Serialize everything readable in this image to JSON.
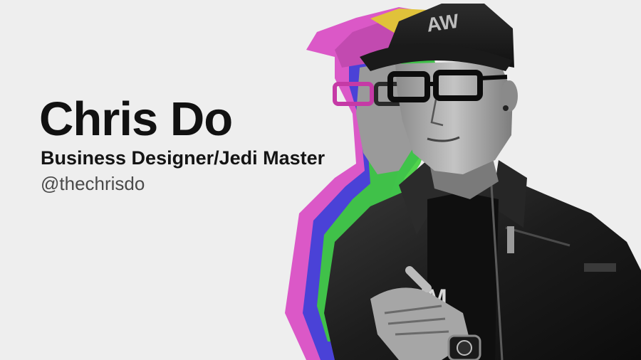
{
  "title_card": {
    "name": "Chris Do",
    "role": "Business Designer/Jedi Master",
    "handle": "@thechrisdo"
  },
  "portrait": {
    "cap_text": "AW",
    "shirt_text": "IM",
    "offset_layer_colors": [
      "#d94fc4",
      "#3a40d8",
      "#3fcf3a",
      "#e8c43a"
    ]
  }
}
